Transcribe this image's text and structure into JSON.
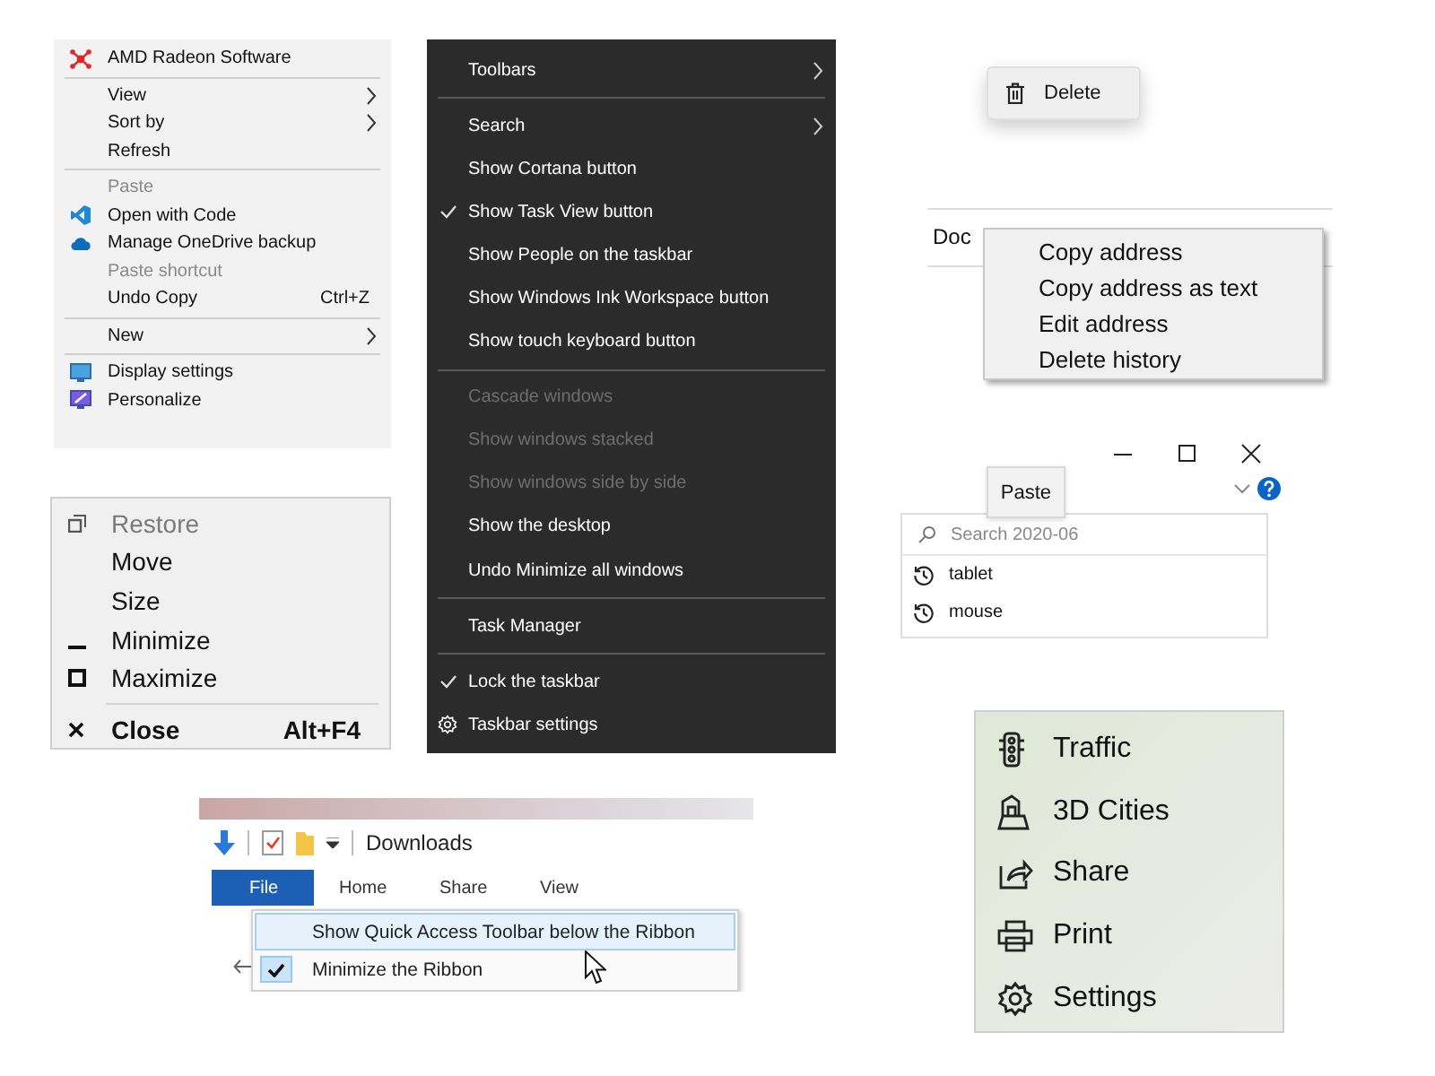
{
  "desktop_menu": {
    "groups": [
      [
        {
          "label": "AMD Radeon Software",
          "disabled": false,
          "submenu": false
        }
      ],
      [
        {
          "label": "View",
          "disabled": false,
          "submenu": true
        },
        {
          "label": "Sort by",
          "disabled": false,
          "submenu": true
        },
        {
          "label": "Refresh",
          "disabled": false,
          "submenu": false
        }
      ],
      [
        {
          "label": "Paste",
          "disabled": true,
          "submenu": false
        },
        {
          "label": "Open with Code",
          "disabled": false,
          "submenu": false
        },
        {
          "label": "Manage OneDrive backup",
          "disabled": false,
          "submenu": false
        },
        {
          "label": "Paste shortcut",
          "disabled": true,
          "submenu": false
        },
        {
          "label": "Undo Copy",
          "shortcut": "Ctrl+Z",
          "disabled": false,
          "submenu": false
        }
      ],
      [
        {
          "label": "New",
          "disabled": false,
          "submenu": true
        }
      ],
      [
        {
          "label": "Display settings",
          "disabled": false,
          "submenu": false
        },
        {
          "label": "Personalize",
          "disabled": false,
          "submenu": false
        }
      ]
    ]
  },
  "system_menu": {
    "groups": [
      [
        {
          "label": "Restore",
          "disabled": true,
          "bold": false
        },
        {
          "label": "Move",
          "disabled": false,
          "bold": false
        },
        {
          "label": "Size",
          "disabled": false,
          "bold": false
        },
        {
          "label": "Minimize",
          "disabled": false,
          "bold": false
        },
        {
          "label": "Maximize",
          "disabled": false,
          "bold": false
        }
      ],
      [
        {
          "label": "Close",
          "shortcut": "Alt+F4",
          "disabled": false,
          "bold": true
        }
      ]
    ]
  },
  "taskbar_menu": {
    "groups": [
      [
        {
          "label": "Toolbars",
          "checked": false,
          "disabled": false,
          "submenu": true
        }
      ],
      [
        {
          "label": "Search",
          "checked": false,
          "disabled": false,
          "submenu": true
        },
        {
          "label": "Show Cortana button",
          "checked": false,
          "disabled": false,
          "submenu": false
        },
        {
          "label": "Show Task View button",
          "checked": true,
          "disabled": false,
          "submenu": false
        },
        {
          "label": "Show People on the taskbar",
          "checked": false,
          "disabled": false,
          "submenu": false
        },
        {
          "label": "Show Windows Ink Workspace button",
          "checked": false,
          "disabled": false,
          "submenu": false
        },
        {
          "label": "Show touch keyboard button",
          "checked": false,
          "disabled": false,
          "submenu": false
        }
      ],
      [
        {
          "label": "Cascade windows",
          "checked": false,
          "disabled": true,
          "submenu": false
        },
        {
          "label": "Show windows stacked",
          "checked": false,
          "disabled": true,
          "submenu": false
        },
        {
          "label": "Show windows side by side",
          "checked": false,
          "disabled": true,
          "submenu": false
        },
        {
          "label": "Show the desktop",
          "checked": false,
          "disabled": false,
          "submenu": false
        },
        {
          "label": "Undo Minimize all windows",
          "checked": false,
          "disabled": false,
          "submenu": false
        }
      ],
      [
        {
          "label": "Task Manager",
          "checked": false,
          "disabled": false,
          "submenu": false
        }
      ],
      [
        {
          "label": "Lock the taskbar",
          "checked": true,
          "disabled": false,
          "submenu": false
        },
        {
          "label": "Taskbar settings",
          "checked": false,
          "disabled": false,
          "submenu": false
        }
      ]
    ]
  },
  "delete_menu": {
    "items": [
      {
        "label": "Delete"
      }
    ]
  },
  "address_bar": {
    "text": "Doc",
    "menu": [
      {
        "label": "Copy address"
      },
      {
        "label": "Copy address as text"
      },
      {
        "label": "Edit address"
      },
      {
        "label": "Delete history"
      }
    ]
  },
  "search_popup": {
    "paste": "Paste",
    "search": {
      "placeholder": "Search 2020-06"
    },
    "history": [
      {
        "label": "tablet"
      },
      {
        "label": "mouse"
      }
    ]
  },
  "explorer": {
    "title": "Downloads",
    "tabs": [
      {
        "label": "File",
        "selected": true
      },
      {
        "label": "Home",
        "selected": false
      },
      {
        "label": "Share",
        "selected": false
      },
      {
        "label": "View",
        "selected": false
      }
    ],
    "menu": [
      {
        "label": "Show Quick Access Toolbar below the Ribbon",
        "highlighted": true,
        "checked": false
      },
      {
        "label": "Minimize the Ribbon",
        "highlighted": false,
        "checked": true
      }
    ]
  },
  "maps_menu": {
    "items": [
      {
        "label": "Traffic"
      },
      {
        "label": "3D Cities"
      },
      {
        "label": "Share"
      },
      {
        "label": "Print"
      },
      {
        "label": "Settings"
      }
    ]
  }
}
